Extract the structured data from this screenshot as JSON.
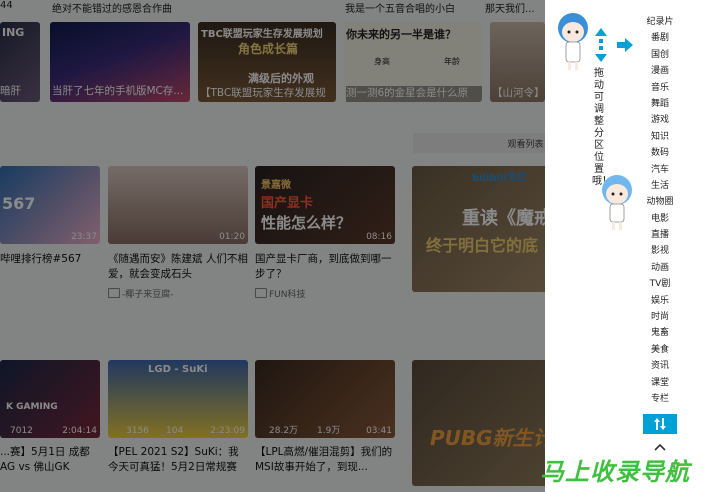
{
  "top_titles": [
    "绝对不能错过的感恩合作曲",
    "我是一个五音合唱的小白",
    "那天我们..."
  ],
  "row1": [
    {
      "title": "当肝了七年的手机版MC存...",
      "caption": "ING"
    },
    {
      "title": "【TBC联盟玩家生存发展规划】",
      "caption": "TBC联盟玩家生存发展规划",
      "caption2": "角色成长篇",
      "caption3": "满级后的外观"
    },
    {
      "title": "测一测6的金星会是什么原型？",
      "caption": "你未来的另一半是谁？",
      "names": [
        "身高",
        "年龄"
      ]
    },
    {
      "title": "【山河令】"
    }
  ],
  "watch_list_label": "观看列表",
  "row2": [
    {
      "title": "哔哩排行榜#567",
      "duration": "23:37",
      "caption": "567"
    },
    {
      "title": "《随遇而安》陈建斌 人们不相爱，就会变成石头",
      "duration": "01:20",
      "owner": "-椰子来豆腐-"
    },
    {
      "title": "国产显卡厂商，到底做到哪一步了？",
      "duration": "08:16",
      "caption": "国产显卡",
      "caption2": "性能怎么样？",
      "tag": "景嘉微",
      "owner": "FUN科技"
    },
    {
      "caption": "重读《魔戒》",
      "caption2": "终于明白它的底",
      "logo": "bilibili专栏"
    }
  ],
  "row3": [
    {
      "title": "...赛】5月1日 成都AG vs 佛山GK",
      "views": "7012",
      "likes": "2:04:14",
      "logo": "K GAMING"
    },
    {
      "title": "【PEL 2021 S2】SuKi：我今天可真猛！5月2日常规赛第...",
      "views": "3156",
      "likes": "104",
      "duration": "2:23:09",
      "tag": "LGD - SuKi"
    },
    {
      "title": "【LPL高燃/催泪混剪】我们的MSI故事开始了，到现...",
      "views": "28.2万",
      "likes": "1.9万",
      "duration": "03:41"
    },
    {
      "caption": "PUBG新生计划"
    }
  ],
  "drag_text": "拖动可调整分区位置哦！",
  "nav_items": [
    "纪录片",
    "番剧",
    "国创",
    "漫画",
    "音乐",
    "舞蹈",
    "游戏",
    "知识",
    "数码",
    "汽车",
    "生活",
    "动物圈",
    "电影",
    "直播",
    "影视",
    "动画",
    "TV剧",
    "娱乐",
    "时尚",
    "鬼畜",
    "美食",
    "资讯",
    "课堂",
    "专栏"
  ],
  "brand": "马上收录导航",
  "colors": {
    "accent": "#00a1d6",
    "brand_green": "#40c040",
    "overlay": "rgba(0,0,0,0.46)"
  }
}
